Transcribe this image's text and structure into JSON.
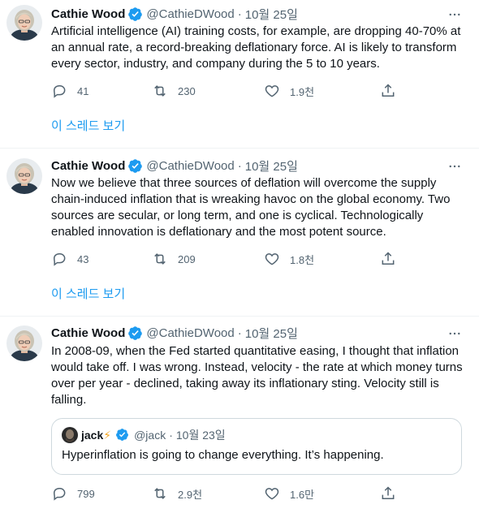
{
  "colors": {
    "accent": "#1d9bf0",
    "muted": "#536471",
    "text": "#0f1419",
    "divider": "#eff3f4"
  },
  "tweets": [
    {
      "name": "Cathie Wood",
      "handle": "@CathieDWood",
      "separator": "·",
      "date": "10월 25일",
      "text": "Artificial intelligence (AI) training costs, for example, are dropping 40-70% at an annual rate, a record-breaking deflationary force. AI is likely to transform every sector, industry, and company during the 5 to 10 years.",
      "replies": "41",
      "retweets": "230",
      "likes": "1.9천",
      "thread_link": "이 스레드 보기"
    },
    {
      "name": "Cathie Wood",
      "handle": "@CathieDWood",
      "separator": "·",
      "date": "10월 25일",
      "text": "Now we believe that three sources of deflation will overcome the supply chain-induced inflation that is wreaking havoc on the global economy. Two sources are secular, or long term, and one is cyclical. Technologically enabled innovation is deflationary and the most potent source.",
      "replies": "43",
      "retweets": "209",
      "likes": "1.8천",
      "thread_link": "이 스레드 보기"
    },
    {
      "name": "Cathie Wood",
      "handle": "@CathieDWood",
      "separator": "·",
      "date": "10월 25일",
      "text": "In 2008-09, when the Fed started quantitative easing, I thought that inflation would take off. I was wrong. Instead, velocity - the rate at which money turns over per year - declined, taking away its inflationary sting. Velocity still is falling.",
      "replies": "799",
      "retweets": "2.9천",
      "likes": "1.6만",
      "quote": {
        "name": "jack",
        "name_emoji": "⚡",
        "handle": "@jack",
        "separator": "·",
        "date": "10월 23일",
        "text": "Hyperinflation is going to change everything. It’s happening."
      }
    }
  ]
}
